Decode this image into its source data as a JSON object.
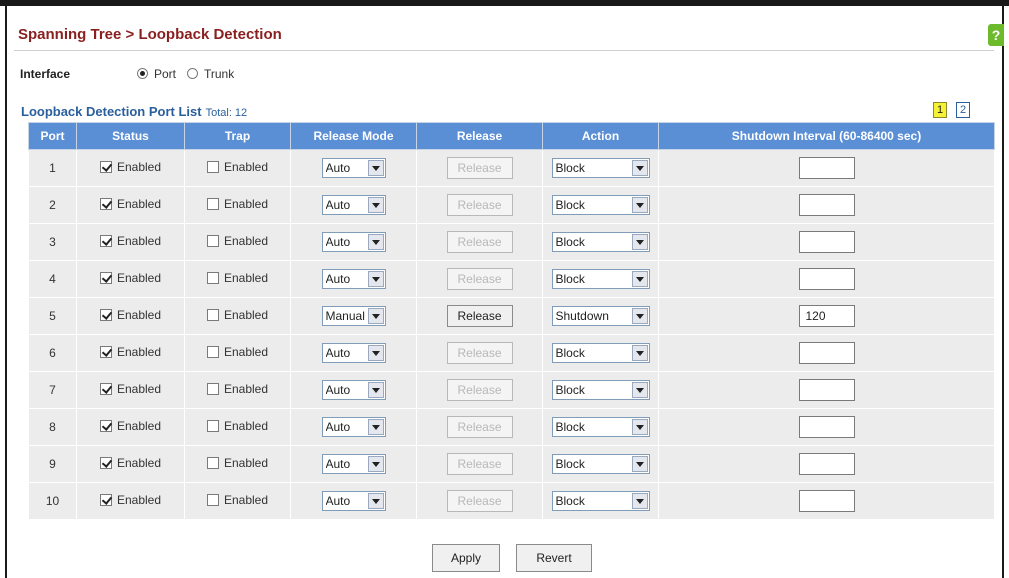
{
  "header": {
    "title": "Spanning Tree > Loopback Detection",
    "help_icon": "?"
  },
  "interface": {
    "label": "Interface",
    "options": [
      {
        "label": "Port",
        "checked": true
      },
      {
        "label": "Trunk",
        "checked": false
      }
    ]
  },
  "list": {
    "title": "Loopback Detection Port List",
    "total": "Total: 12",
    "pages": [
      "1",
      "2"
    ],
    "active_page": "1"
  },
  "table": {
    "columns": [
      "Port",
      "Status",
      "Trap",
      "Release Mode",
      "Release",
      "Action",
      "Shutdown Interval (60-86400 sec)"
    ],
    "rows": [
      {
        "port": "1",
        "status": "Enabled",
        "status_checked": true,
        "trap": "Enabled",
        "trap_checked": false,
        "release_mode": "Auto",
        "release": "Release",
        "release_enabled": false,
        "action": "Block",
        "interval": ""
      },
      {
        "port": "2",
        "status": "Enabled",
        "status_checked": true,
        "trap": "Enabled",
        "trap_checked": false,
        "release_mode": "Auto",
        "release": "Release",
        "release_enabled": false,
        "action": "Block",
        "interval": ""
      },
      {
        "port": "3",
        "status": "Enabled",
        "status_checked": true,
        "trap": "Enabled",
        "trap_checked": false,
        "release_mode": "Auto",
        "release": "Release",
        "release_enabled": false,
        "action": "Block",
        "interval": ""
      },
      {
        "port": "4",
        "status": "Enabled",
        "status_checked": true,
        "trap": "Enabled",
        "trap_checked": false,
        "release_mode": "Auto",
        "release": "Release",
        "release_enabled": false,
        "action": "Block",
        "interval": ""
      },
      {
        "port": "5",
        "status": "Enabled",
        "status_checked": true,
        "trap": "Enabled",
        "trap_checked": false,
        "release_mode": "Manual",
        "release": "Release",
        "release_enabled": true,
        "action": "Shutdown",
        "interval": "120"
      },
      {
        "port": "6",
        "status": "Enabled",
        "status_checked": true,
        "trap": "Enabled",
        "trap_checked": false,
        "release_mode": "Auto",
        "release": "Release",
        "release_enabled": false,
        "action": "Block",
        "interval": ""
      },
      {
        "port": "7",
        "status": "Enabled",
        "status_checked": true,
        "trap": "Enabled",
        "trap_checked": false,
        "release_mode": "Auto",
        "release": "Release",
        "release_enabled": false,
        "action": "Block",
        "interval": ""
      },
      {
        "port": "8",
        "status": "Enabled",
        "status_checked": true,
        "trap": "Enabled",
        "trap_checked": false,
        "release_mode": "Auto",
        "release": "Release",
        "release_enabled": false,
        "action": "Block",
        "interval": ""
      },
      {
        "port": "9",
        "status": "Enabled",
        "status_checked": true,
        "trap": "Enabled",
        "trap_checked": false,
        "release_mode": "Auto",
        "release": "Release",
        "release_enabled": false,
        "action": "Block",
        "interval": ""
      },
      {
        "port": "10",
        "status": "Enabled",
        "status_checked": true,
        "trap": "Enabled",
        "trap_checked": false,
        "release_mode": "Auto",
        "release": "Release",
        "release_enabled": false,
        "action": "Block",
        "interval": ""
      }
    ]
  },
  "footer": {
    "apply_label": "Apply",
    "revert_label": "Revert"
  },
  "colors": {
    "title": "#8a1f1f",
    "header_bg": "#5a8fd6",
    "link": "#2a5f9e",
    "row_bg": "#ececec",
    "active_page_bg": "#f5f135"
  }
}
